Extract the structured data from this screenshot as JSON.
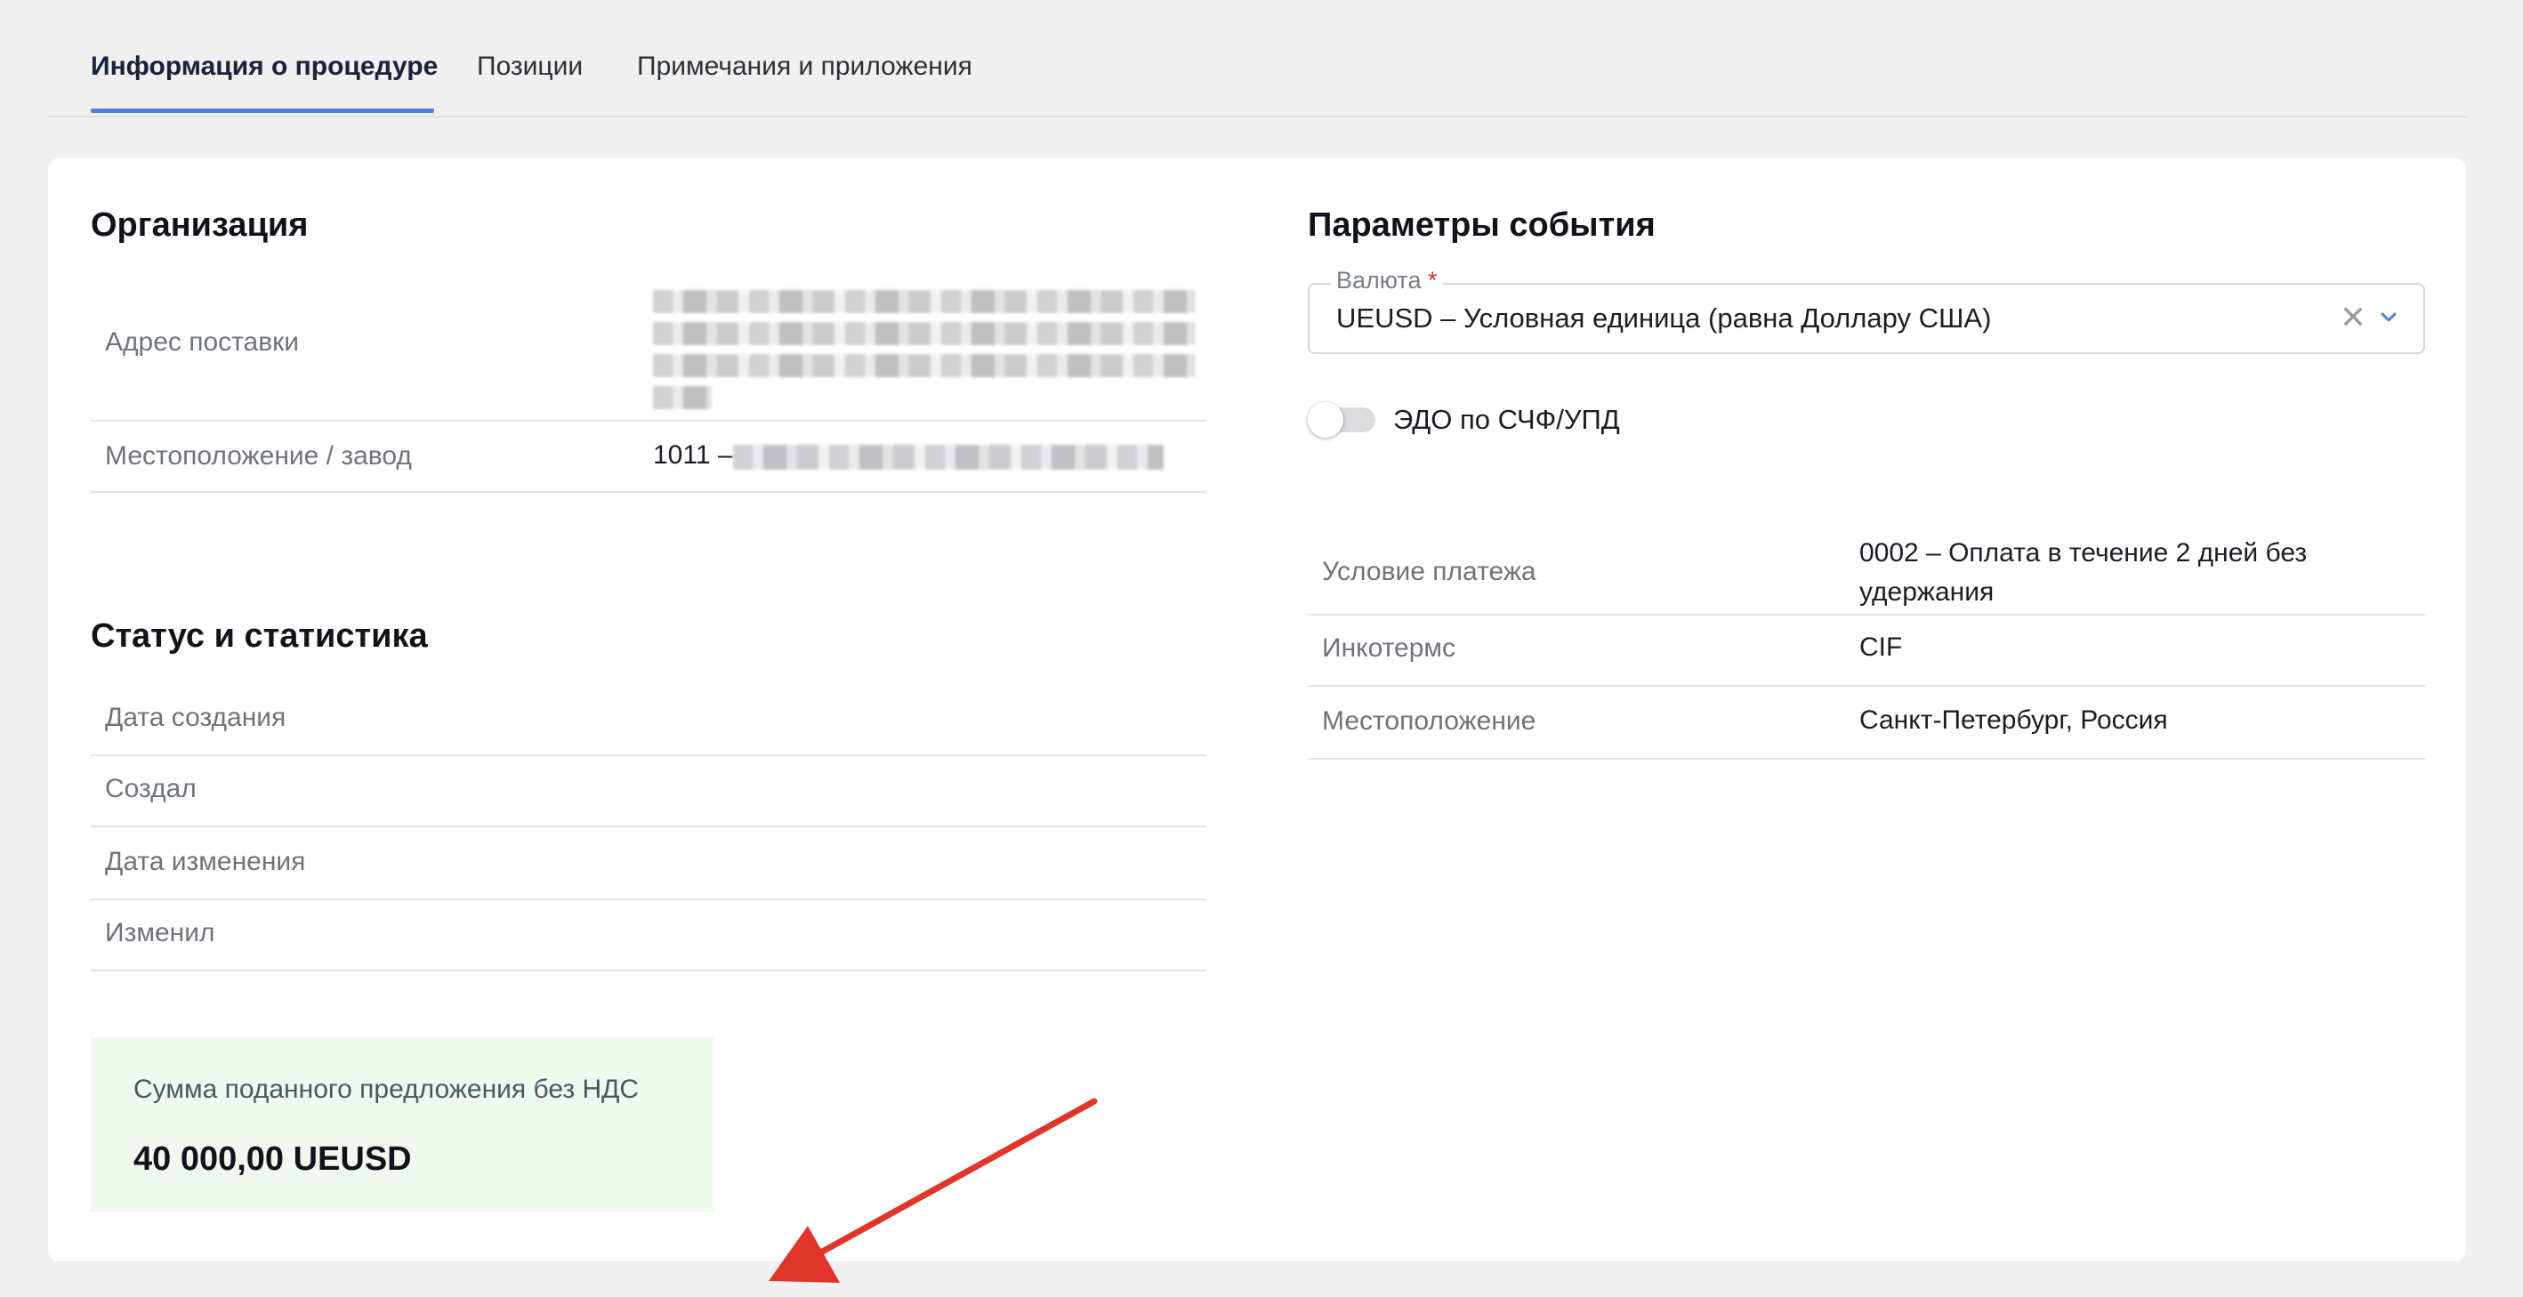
{
  "tabs": [
    {
      "label": "Информация о процедуре",
      "active": true
    },
    {
      "label": "Позиции",
      "active": false
    },
    {
      "label": "Примечания и приложения",
      "active": false
    }
  ],
  "organization": {
    "title": "Организация",
    "rows": [
      {
        "label": "Адрес поставки",
        "value": ""
      },
      {
        "label": "Местоположение / завод",
        "value": "1011 –"
      }
    ]
  },
  "status": {
    "title": "Статус и статистика",
    "rows": [
      {
        "label": "Дата создания",
        "value": ""
      },
      {
        "label": "Создал",
        "value": ""
      },
      {
        "label": "Дата изменения",
        "value": ""
      },
      {
        "label": "Изменил",
        "value": ""
      }
    ]
  },
  "event_params": {
    "title": "Параметры события",
    "currency": {
      "label": "Валюта",
      "required_mark": "*",
      "value": "UEUSD – Условная единица (равна Доллару США)",
      "clear_glyph": "✕"
    },
    "edo_toggle": {
      "label": "ЭДО по СЧФ/УПД",
      "enabled": false
    },
    "rows": [
      {
        "label": "Условие платежа",
        "value": "0002 – Оплата в течение 2 дней без удержания"
      },
      {
        "label": "Инкотермс",
        "value": "CIF"
      },
      {
        "label": "Местоположение",
        "value": "Санкт-Петербург, Россия"
      }
    ]
  },
  "summary": {
    "label": "Сумма поданного предложения без НДС",
    "value": "40 000,00 UEUSD"
  },
  "colors": {
    "accent": "#4f7fe2",
    "summary_bg": "#f1f8ef",
    "arrow": "#e0352b",
    "required": "#d0342c"
  }
}
